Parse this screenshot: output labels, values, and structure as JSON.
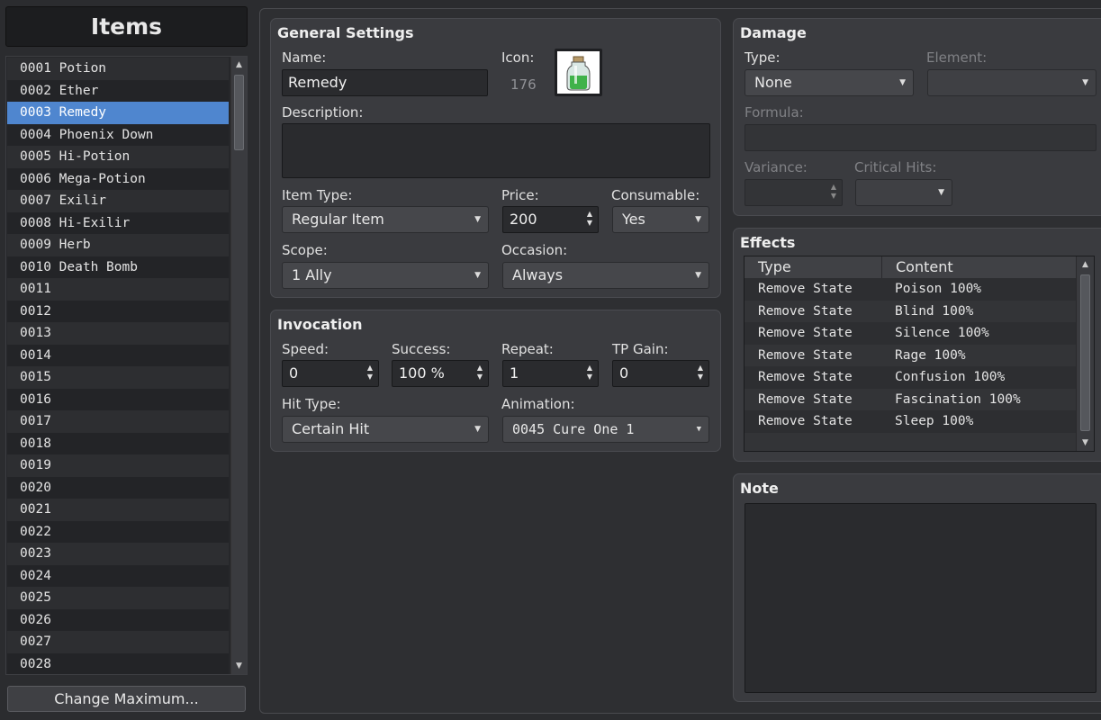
{
  "sidebar": {
    "title": "Items",
    "items": [
      "0001 Potion",
      "0002 Ether",
      "0003 Remedy",
      "0004 Phoenix Down",
      "0005 Hi-Potion",
      "0006 Mega-Potion",
      "0007 Exilir",
      "0008 Hi-Exilir",
      "0009 Herb",
      "0010 Death Bomb",
      "0011",
      "0012",
      "0013",
      "0014",
      "0015",
      "0016",
      "0017",
      "0018",
      "0019",
      "0020",
      "0021",
      "0022",
      "0023",
      "0024",
      "0025",
      "0026",
      "0027",
      "0028"
    ],
    "selected_index": 2,
    "change_max_label": "Change Maximum..."
  },
  "general": {
    "title": "General Settings",
    "name_label": "Name:",
    "name_value": "Remedy",
    "icon_label": "Icon:",
    "icon_index": "176",
    "icon_name": "potion-bottle-icon",
    "description_label": "Description:",
    "description_value": "",
    "item_type_label": "Item Type:",
    "item_type_value": "Regular Item",
    "price_label": "Price:",
    "price_value": "200",
    "consumable_label": "Consumable:",
    "consumable_value": "Yes",
    "scope_label": "Scope:",
    "scope_value": "1 Ally",
    "occasion_label": "Occasion:",
    "occasion_value": "Always"
  },
  "invocation": {
    "title": "Invocation",
    "speed_label": "Speed:",
    "speed_value": "0",
    "success_label": "Success:",
    "success_value": "100 %",
    "repeat_label": "Repeat:",
    "repeat_value": "1",
    "tp_gain_label": "TP Gain:",
    "tp_gain_value": "0",
    "hit_type_label": "Hit Type:",
    "hit_type_value": "Certain Hit",
    "animation_label": "Animation:",
    "animation_value": "0045 Cure One 1"
  },
  "damage": {
    "title": "Damage",
    "type_label": "Type:",
    "type_value": "None",
    "element_label": "Element:",
    "element_value": "",
    "formula_label": "Formula:",
    "formula_value": "",
    "variance_label": "Variance:",
    "variance_value": "",
    "critical_label": "Critical Hits:",
    "critical_value": ""
  },
  "effects": {
    "title": "Effects",
    "columns": [
      "Type",
      "Content"
    ],
    "rows": [
      {
        "type": "Remove State",
        "content": "Poison 100%"
      },
      {
        "type": "Remove State",
        "content": "Blind 100%"
      },
      {
        "type": "Remove State",
        "content": "Silence 100%"
      },
      {
        "type": "Remove State",
        "content": "Rage 100%"
      },
      {
        "type": "Remove State",
        "content": "Confusion 100%"
      },
      {
        "type": "Remove State",
        "content": "Fascination 100%"
      },
      {
        "type": "Remove State",
        "content": "Sleep 100%"
      }
    ]
  },
  "note": {
    "title": "Note",
    "value": ""
  },
  "colors": {
    "selection": "#4f86cf",
    "background": "#2b2c2f"
  }
}
